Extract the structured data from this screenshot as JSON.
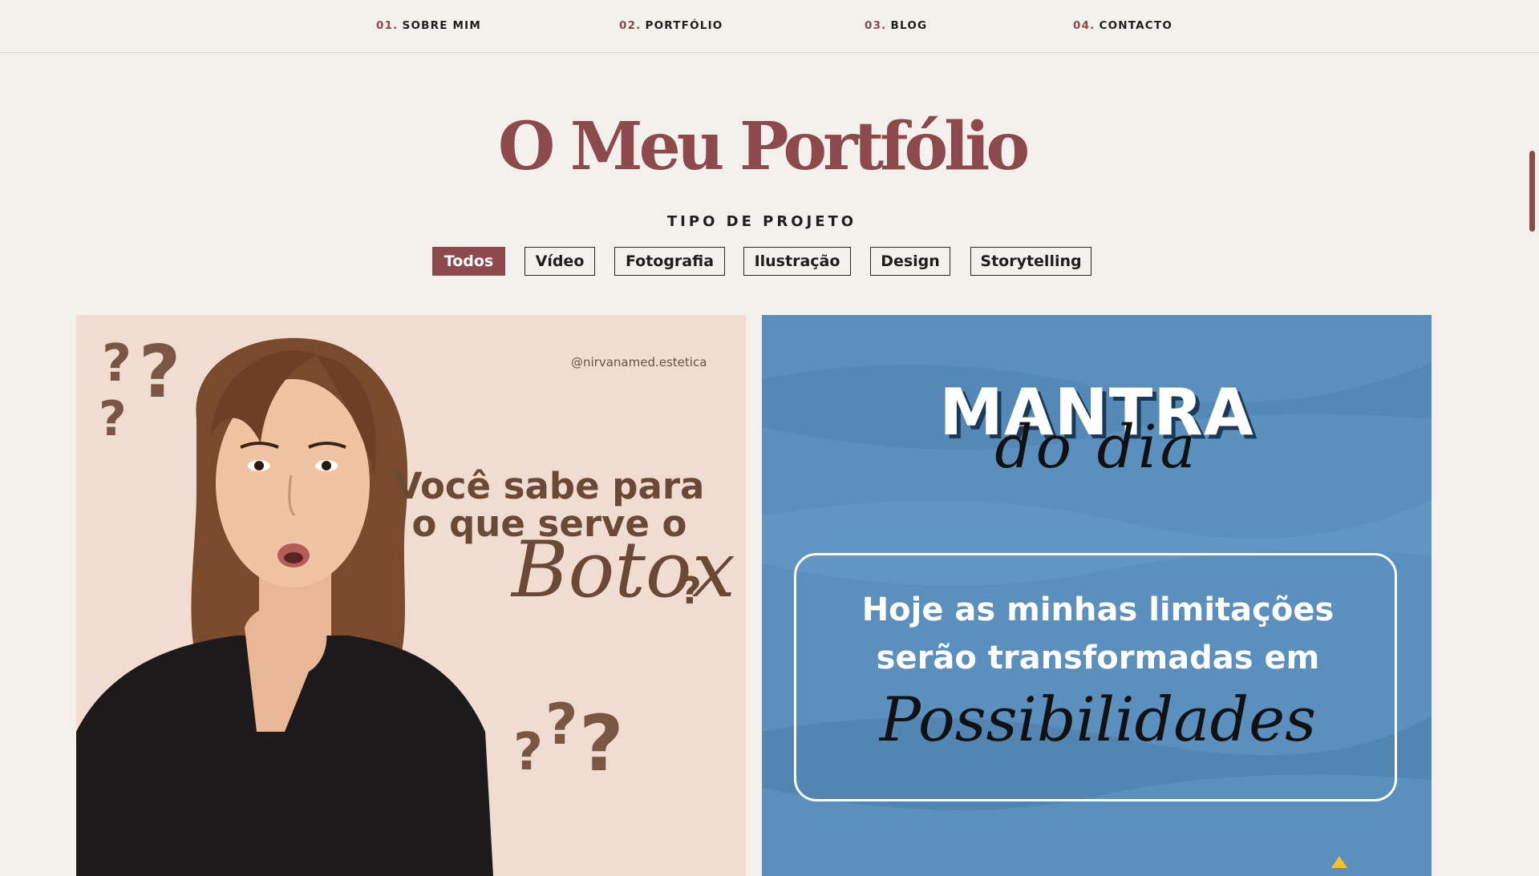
{
  "nav": {
    "items": [
      {
        "num": "01.",
        "label": "SOBRE MIM"
      },
      {
        "num": "02.",
        "label": "PORTFÓLIO"
      },
      {
        "num": "03.",
        "label": "BLOG"
      },
      {
        "num": "04.",
        "label": "CONTACTO"
      }
    ]
  },
  "header": {
    "title": "O Meu Portfólio",
    "subtitle": "TIPO DE PROJETO"
  },
  "filters": [
    {
      "label": "Todos",
      "active": true
    },
    {
      "label": "Vídeo",
      "active": false
    },
    {
      "label": "Fotografia",
      "active": false
    },
    {
      "label": "Ilustração",
      "active": false
    },
    {
      "label": "Design",
      "active": false
    },
    {
      "label": "Storytelling",
      "active": false
    }
  ],
  "cards": {
    "left": {
      "handle": "@nirvanamed.estetica",
      "line1": "Você sabe para",
      "line2": "o que serve o",
      "script": "Botox",
      "qmark": "?"
    },
    "right": {
      "title": "MANTRA",
      "title_script": "do dia",
      "quote_line1": "Hoje as minhas limitações",
      "quote_line2": "serão transformadas em",
      "quote_script": "Possibilidades"
    }
  },
  "colors": {
    "accent": "#8c4a4c",
    "background": "#f4f0eb",
    "left_card": "#f0dcd0",
    "right_card": "#5b8fbd"
  }
}
